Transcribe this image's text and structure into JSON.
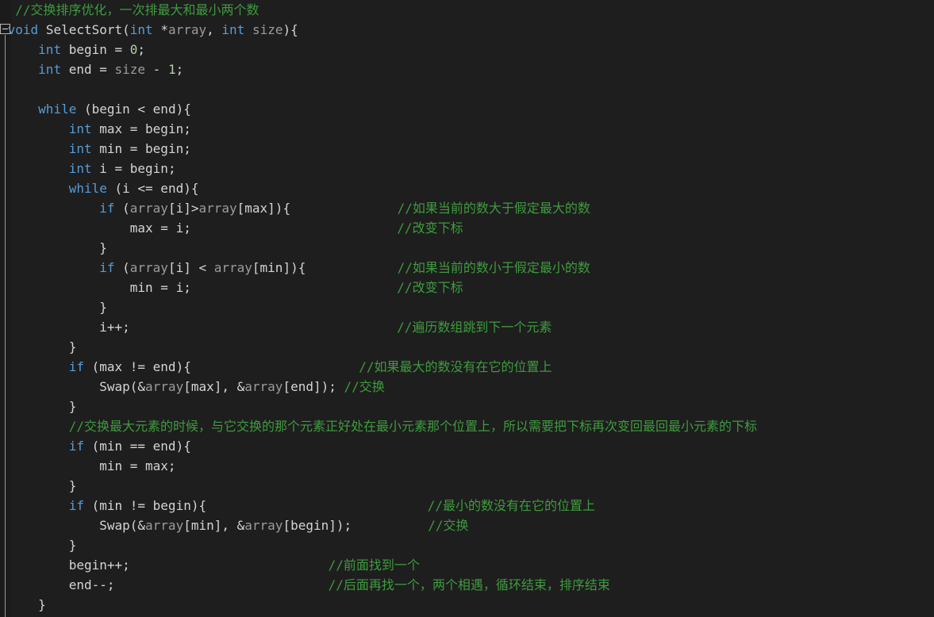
{
  "editor": {
    "language": "cpp",
    "background_color": "#1e1e1e",
    "gutter_color": "#1b1b1b",
    "guide_color": "#9a9a9a",
    "font_size_px": 16,
    "line_height_px": 25,
    "colors": {
      "keyword": "#569cd6",
      "identifier": "#d4d4d4",
      "dim_identifier": "#9b9b9b",
      "number": "#b5cea8",
      "comment": "#3e9b3e"
    },
    "fold_toggle": {
      "state": "expanded",
      "glyph": "minus",
      "line": 2
    }
  },
  "code": {
    "lines": [
      [
        {
          "t": "//交换排序优化，一次排最大和最小两个数",
          "c": "cm",
          "pad": 2
        }
      ],
      [
        {
          "t": "void",
          "c": "kw",
          "pad": 1
        },
        {
          "t": " ",
          "c": "id"
        },
        {
          "t": "SelectSort",
          "c": "id"
        },
        {
          "t": "(",
          "c": "id"
        },
        {
          "t": "int",
          "c": "kw"
        },
        {
          "t": " *",
          "c": "id"
        },
        {
          "t": "array",
          "c": "dim"
        },
        {
          "t": ", ",
          "c": "id"
        },
        {
          "t": "int",
          "c": "kw"
        },
        {
          "t": " ",
          "c": "id"
        },
        {
          "t": "size",
          "c": "dim"
        },
        {
          "t": "){",
          "c": "id"
        }
      ],
      [
        {
          "t": "int",
          "c": "kw",
          "pad": 5
        },
        {
          "t": " begin = ",
          "c": "id"
        },
        {
          "t": "0",
          "c": "num"
        },
        {
          "t": ";",
          "c": "id"
        }
      ],
      [
        {
          "t": "int",
          "c": "kw",
          "pad": 5
        },
        {
          "t": " end = ",
          "c": "id"
        },
        {
          "t": "size",
          "c": "dim"
        },
        {
          "t": " - ",
          "c": "id"
        },
        {
          "t": "1",
          "c": "num"
        },
        {
          "t": ";",
          "c": "id"
        }
      ],
      [],
      [
        {
          "t": "while",
          "c": "kw",
          "pad": 5
        },
        {
          "t": " (begin < end){",
          "c": "id"
        }
      ],
      [
        {
          "t": "int",
          "c": "kw",
          "pad": 9
        },
        {
          "t": " max = begin;",
          "c": "id"
        }
      ],
      [
        {
          "t": "int",
          "c": "kw",
          "pad": 9
        },
        {
          "t": " min = begin;",
          "c": "id"
        }
      ],
      [
        {
          "t": "int",
          "c": "kw",
          "pad": 9
        },
        {
          "t": " i = begin;",
          "c": "id"
        }
      ],
      [
        {
          "t": "while",
          "c": "kw",
          "pad": 9
        },
        {
          "t": " (i <= end){",
          "c": "id"
        }
      ],
      [
        {
          "t": "if",
          "c": "kw",
          "pad": 13
        },
        {
          "t": " (",
          "c": "id"
        },
        {
          "t": "array",
          "c": "dim"
        },
        {
          "t": "[i]>",
          "c": "id"
        },
        {
          "t": "array",
          "c": "dim"
        },
        {
          "t": "[max]){",
          "c": "id"
        },
        {
          "t": "//如果当前的数大于假定最大的数",
          "c": "cm",
          "col": 52
        }
      ],
      [
        {
          "t": "max = i;",
          "c": "id",
          "pad": 17
        },
        {
          "t": "//改变下标",
          "c": "cm",
          "col": 52
        }
      ],
      [
        {
          "t": "}",
          "c": "id",
          "pad": 13
        }
      ],
      [
        {
          "t": "if",
          "c": "kw",
          "pad": 13
        },
        {
          "t": " (",
          "c": "id"
        },
        {
          "t": "array",
          "c": "dim"
        },
        {
          "t": "[i] < ",
          "c": "id"
        },
        {
          "t": "array",
          "c": "dim"
        },
        {
          "t": "[min]){",
          "c": "id"
        },
        {
          "t": "//如果当前的数小于假定最小的数",
          "c": "cm",
          "col": 52
        }
      ],
      [
        {
          "t": "min = i;",
          "c": "id",
          "pad": 17
        },
        {
          "t": "//改变下标",
          "c": "cm",
          "col": 52
        }
      ],
      [
        {
          "t": "}",
          "c": "id",
          "pad": 13
        }
      ],
      [
        {
          "t": "i++;",
          "c": "id",
          "pad": 13
        },
        {
          "t": "//遍历数组跳到下一个元素",
          "c": "cm",
          "col": 52
        }
      ],
      [
        {
          "t": "}",
          "c": "id",
          "pad": 9
        }
      ],
      [
        {
          "t": "if",
          "c": "kw",
          "pad": 9
        },
        {
          "t": " (max != end){",
          "c": "id"
        },
        {
          "t": "//如果最大的数没有在它的位置上",
          "c": "cm",
          "col": 47
        }
      ],
      [
        {
          "t": "Swap",
          "c": "id",
          "pad": 13
        },
        {
          "t": "(&",
          "c": "id"
        },
        {
          "t": "array",
          "c": "dim"
        },
        {
          "t": "[max], &",
          "c": "id"
        },
        {
          "t": "array",
          "c": "dim"
        },
        {
          "t": "[end]); ",
          "c": "id"
        },
        {
          "t": "//交换",
          "c": "cm"
        }
      ],
      [
        {
          "t": "}",
          "c": "id",
          "pad": 9
        }
      ],
      [
        {
          "t": "//交换最大元素的时候，与它交换的那个元素正好处在最小元素那个位置上，所以需要把下标再次变回最回最小元素的下标",
          "c": "cm",
          "pad": 9
        }
      ],
      [
        {
          "t": "if",
          "c": "kw",
          "pad": 9
        },
        {
          "t": " (min == end){",
          "c": "id"
        }
      ],
      [
        {
          "t": "min = max;",
          "c": "id",
          "pad": 13
        }
      ],
      [
        {
          "t": "}",
          "c": "id",
          "pad": 9
        }
      ],
      [
        {
          "t": "if",
          "c": "kw",
          "pad": 9
        },
        {
          "t": " (min != begin){",
          "c": "id"
        },
        {
          "t": "//最小的数没有在它的位置上",
          "c": "cm",
          "col": 56
        }
      ],
      [
        {
          "t": "Swap",
          "c": "id",
          "pad": 13
        },
        {
          "t": "(&",
          "c": "id"
        },
        {
          "t": "array",
          "c": "dim"
        },
        {
          "t": "[min], &",
          "c": "id"
        },
        {
          "t": "array",
          "c": "dim"
        },
        {
          "t": "[begin]);",
          "c": "id"
        },
        {
          "t": "//交换",
          "c": "cm",
          "col": 56
        }
      ],
      [
        {
          "t": "}",
          "c": "id",
          "pad": 9
        }
      ],
      [
        {
          "t": "begin++;",
          "c": "id",
          "pad": 9
        },
        {
          "t": "//前面找到一个",
          "c": "cm",
          "col": 43
        }
      ],
      [
        {
          "t": "end--;",
          "c": "id",
          "pad": 9
        },
        {
          "t": "//后面再找一个，两个相遇，循环结束，排序结束",
          "c": "cm",
          "col": 43
        }
      ],
      [
        {
          "t": "}",
          "c": "id",
          "pad": 5
        }
      ]
    ]
  }
}
